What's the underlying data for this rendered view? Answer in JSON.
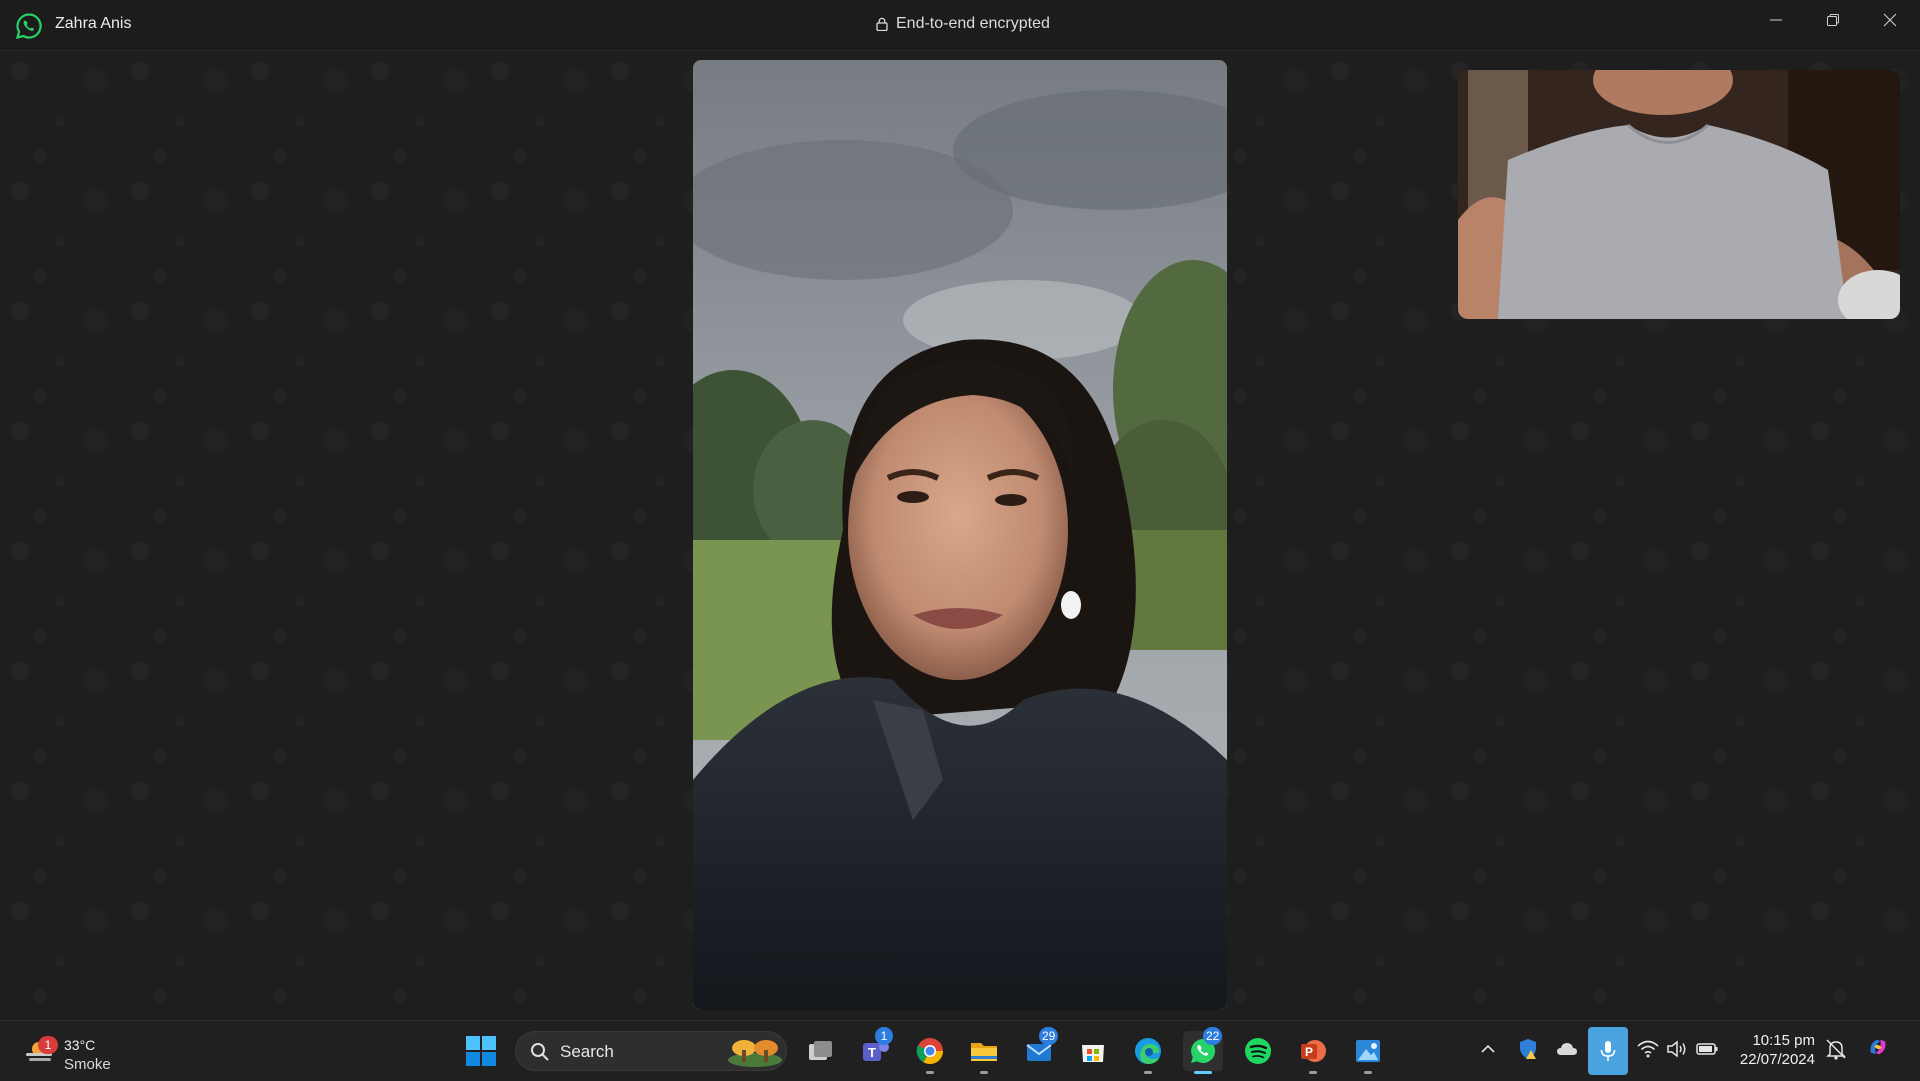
{
  "window": {
    "contact_name": "Zahra Anis",
    "encryption_text": "End-to-end encrypted",
    "controls": [
      "minimize-icon",
      "restore-icon",
      "close-icon"
    ]
  },
  "call": {
    "remote_participant": "Zahra Anis",
    "layout": "remote video centered, self view top-right"
  },
  "taskbar": {
    "weather": {
      "temperature": "33°C",
      "condition": "Smoke",
      "alert_count": "1"
    },
    "search_placeholder": "Search",
    "apps": [
      {
        "name": "task-view",
        "badge": ""
      },
      {
        "name": "teams",
        "badge": "1"
      },
      {
        "name": "chrome",
        "badge": ""
      },
      {
        "name": "file-explorer",
        "badge": ""
      },
      {
        "name": "mail",
        "badge": "29"
      },
      {
        "name": "microsoft-store",
        "badge": ""
      },
      {
        "name": "edge",
        "badge": ""
      },
      {
        "name": "whatsapp",
        "badge": "22"
      },
      {
        "name": "spotify",
        "badge": ""
      },
      {
        "name": "powerpoint",
        "badge": ""
      },
      {
        "name": "photos",
        "badge": ""
      }
    ],
    "clock": {
      "time": "10:15 pm",
      "date": "22/07/2024"
    }
  },
  "colors": {
    "whatsapp_green": "#25d366",
    "accent_blue": "#60cdff",
    "badge_red": "#d83b3b",
    "mic_active": "#4aa3df"
  }
}
